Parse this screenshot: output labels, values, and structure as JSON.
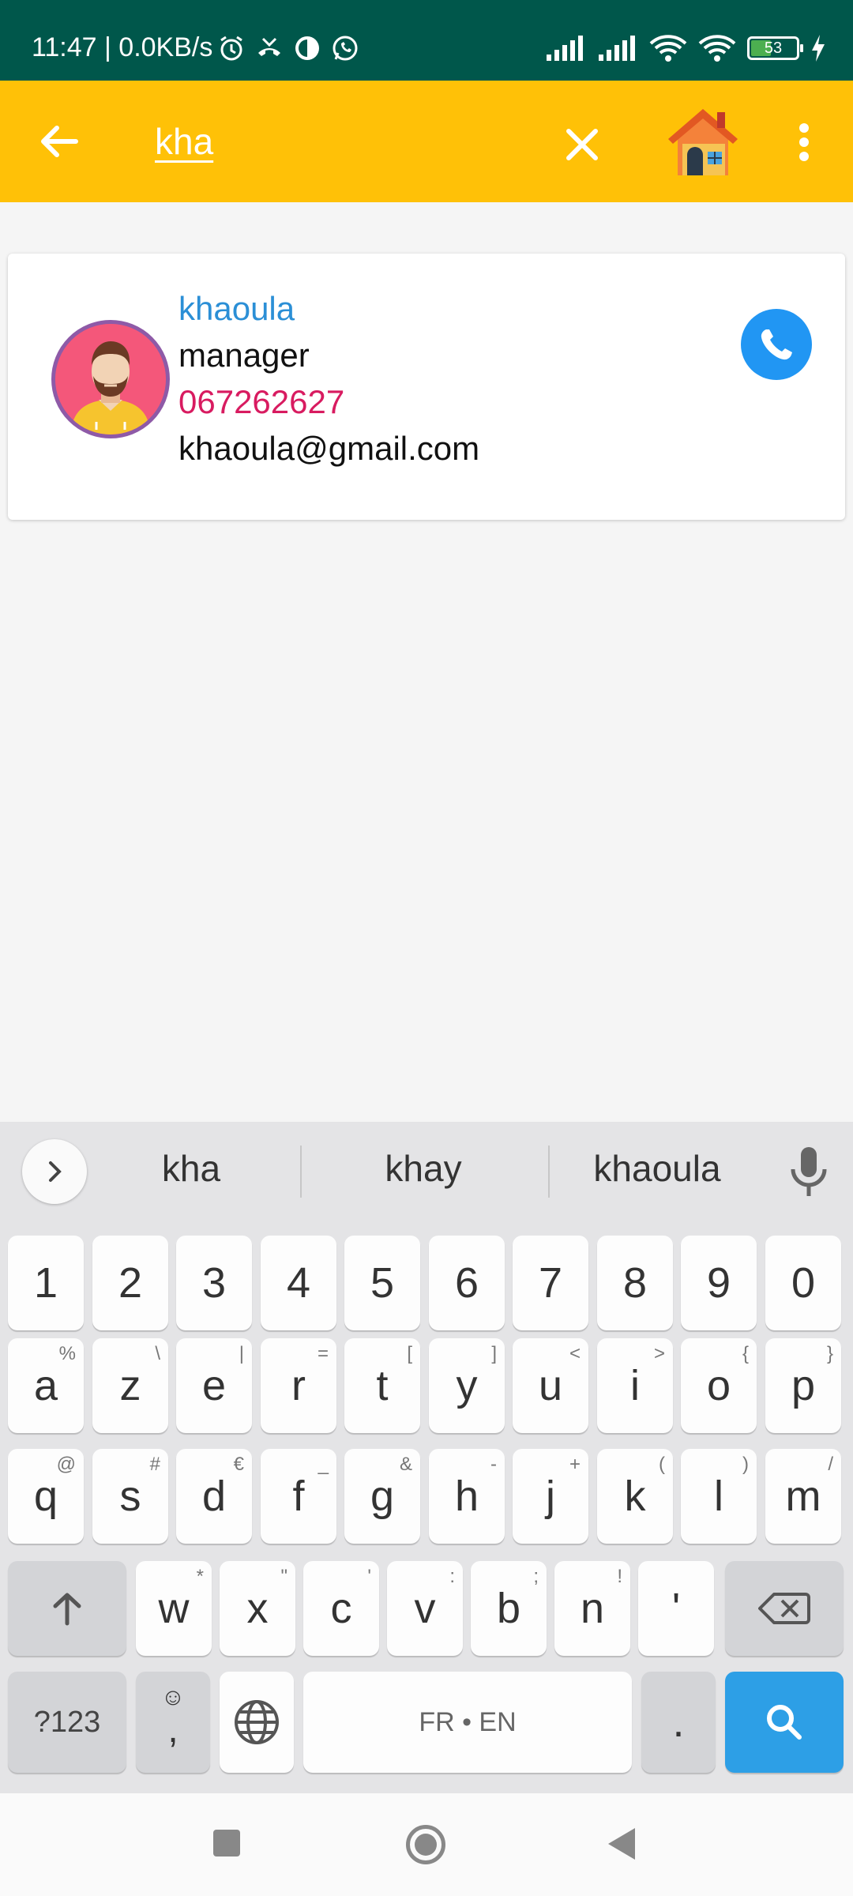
{
  "status_bar": {
    "time_text": "11:47 | 0.0KB/s",
    "battery_level": "53"
  },
  "toolbar": {
    "search_value": "kha",
    "background_color": "#ffc107"
  },
  "contact": {
    "name": "khaoula",
    "role": "manager",
    "phone": "067262627",
    "email": "khaoula@gmail.com"
  },
  "keyboard": {
    "suggestions": [
      "kha",
      "khay",
      "khaoula"
    ],
    "number_row": [
      "1",
      "2",
      "3",
      "4",
      "5",
      "6",
      "7",
      "8",
      "9",
      "0"
    ],
    "row1": [
      {
        "key": "a",
        "hint": "%"
      },
      {
        "key": "z",
        "hint": "\\"
      },
      {
        "key": "e",
        "hint": "|"
      },
      {
        "key": "r",
        "hint": "="
      },
      {
        "key": "t",
        "hint": "["
      },
      {
        "key": "y",
        "hint": "]"
      },
      {
        "key": "u",
        "hint": "<"
      },
      {
        "key": "i",
        "hint": ">"
      },
      {
        "key": "o",
        "hint": "{"
      },
      {
        "key": "p",
        "hint": "}"
      }
    ],
    "row2": [
      {
        "key": "q",
        "hint": "@"
      },
      {
        "key": "s",
        "hint": "#"
      },
      {
        "key": "d",
        "hint": "€"
      },
      {
        "key": "f",
        "hint": "_"
      },
      {
        "key": "g",
        "hint": "&"
      },
      {
        "key": "h",
        "hint": "-"
      },
      {
        "key": "j",
        "hint": "+"
      },
      {
        "key": "k",
        "hint": "("
      },
      {
        "key": "l",
        "hint": ")"
      },
      {
        "key": "m",
        "hint": "/"
      }
    ],
    "row3": [
      {
        "key": "w",
        "hint": "*"
      },
      {
        "key": "x",
        "hint": "\""
      },
      {
        "key": "c",
        "hint": "'"
      },
      {
        "key": "v",
        "hint": ":"
      },
      {
        "key": "b",
        "hint": ";"
      },
      {
        "key": "n",
        "hint": "!"
      },
      {
        "key": "'",
        "hint": ""
      }
    ],
    "sym_label": "?123",
    "comma_label": ",",
    "space_label": "FR • EN",
    "period_label": "."
  }
}
